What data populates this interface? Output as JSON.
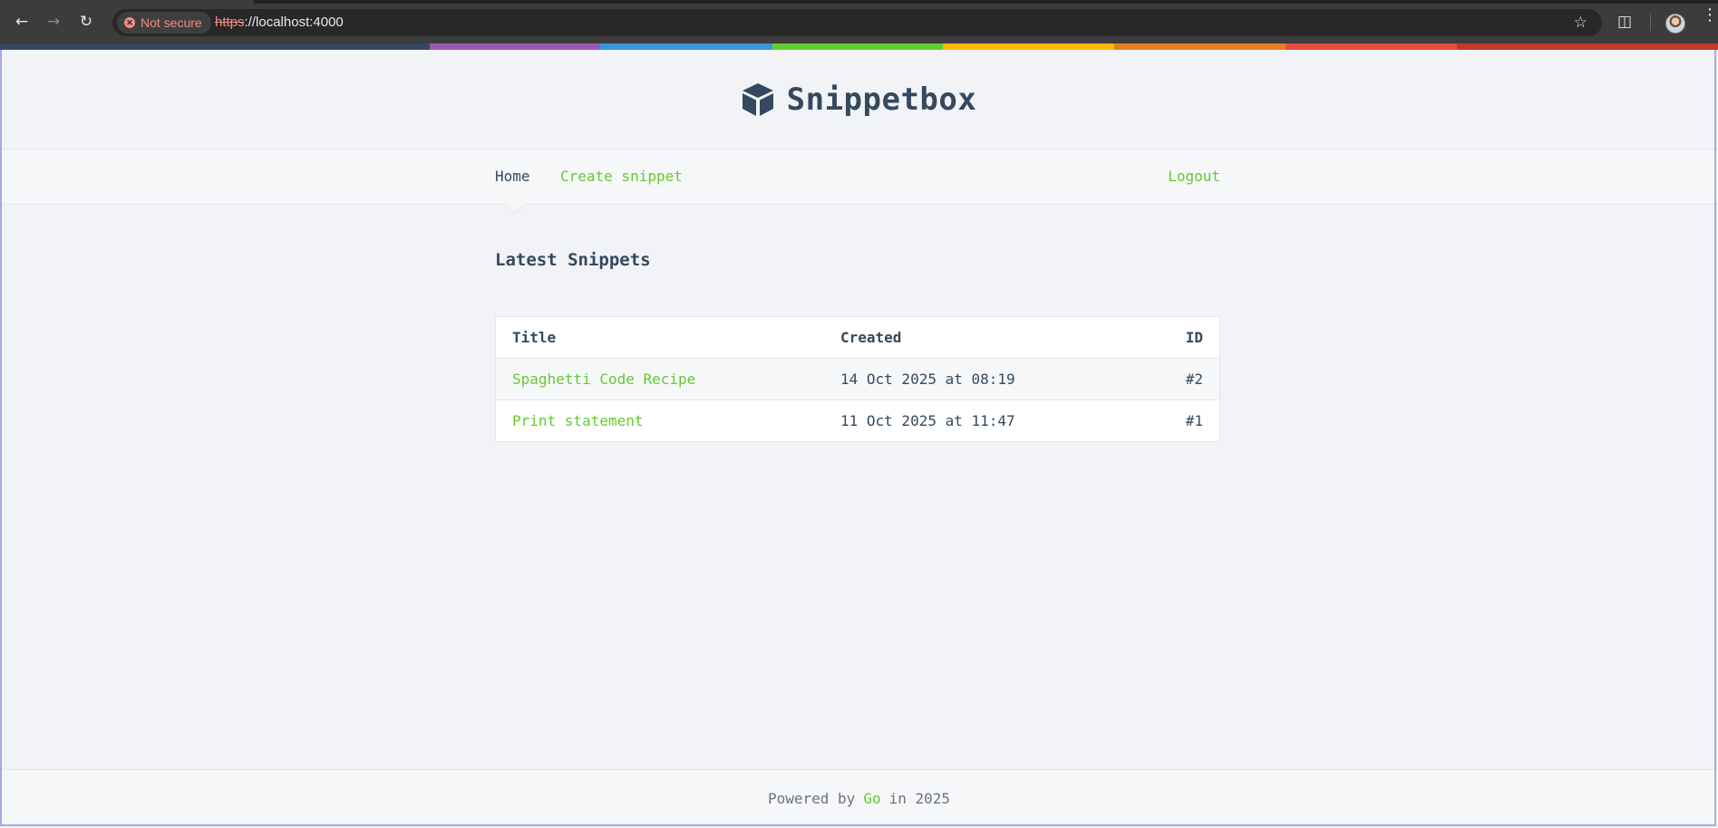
{
  "browser": {
    "security_label": "Not secure",
    "url_scheme": "https",
    "url_rest": "://localhost:4000",
    "back_icon": "back-arrow-icon",
    "forward_icon": "forward-arrow-icon",
    "reload_icon": "reload-icon"
  },
  "rainbow_colors": [
    "#34495e",
    "#9b59b6",
    "#3498db",
    "#62cb31",
    "#ffb606",
    "#e67e22",
    "#e74c3c",
    "#c0392b"
  ],
  "site": {
    "title": "Snippetbox",
    "logo_icon": "cube-icon"
  },
  "nav": {
    "home": "Home",
    "create": "Create snippet",
    "logout": "Logout"
  },
  "main": {
    "heading": "Latest Snippets",
    "table": {
      "headers": {
        "title": "Title",
        "created": "Created",
        "id": "ID"
      },
      "rows": [
        {
          "title": "Spaghetti Code Recipe",
          "created": "14 Oct 2025 at 08:19",
          "id": "#2"
        },
        {
          "title": "Print statement",
          "created": "11 Oct 2025 at 11:47",
          "id": "#1"
        }
      ]
    }
  },
  "footer": {
    "prefix": "Powered by",
    "link": "Go",
    "suffix": "in 2025"
  },
  "colors": {
    "accent": "#62cb31",
    "text": "#34495e",
    "background": "#f1f3f6"
  }
}
